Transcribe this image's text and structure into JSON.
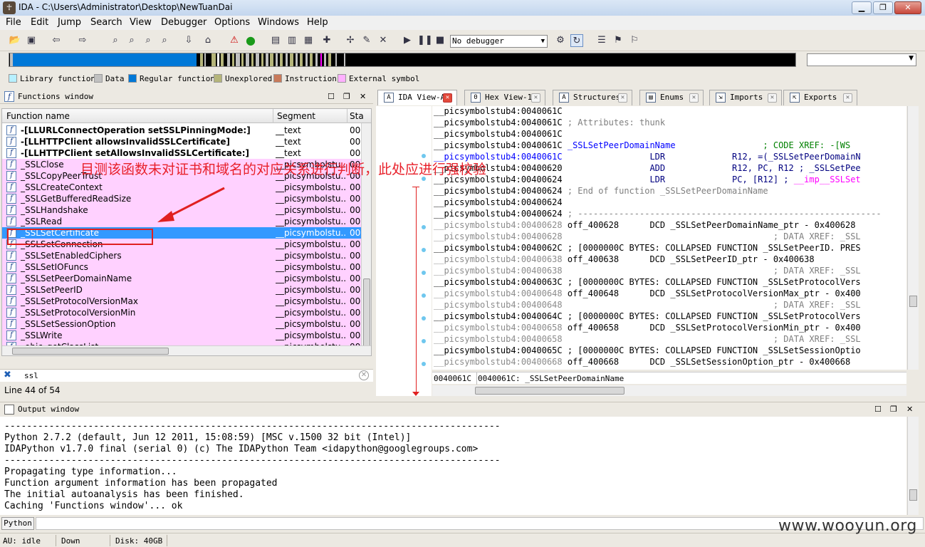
{
  "window": {
    "title": "IDA - C:\\Users\\Administrator\\Desktop\\NewTuanDai"
  },
  "menu": [
    "File",
    "Edit",
    "Jump",
    "Search",
    "View",
    "Debugger",
    "Options",
    "Windows",
    "Help"
  ],
  "toolbar": {
    "debugger_select": "No debugger"
  },
  "legend": [
    {
      "label": "Library function",
      "color": "#b7f0ff"
    },
    {
      "label": "Data",
      "color": "#c0c0c0"
    },
    {
      "label": "Regular function",
      "color": "#0078d7"
    },
    {
      "label": "Unexplored",
      "color": "#b5b57a"
    },
    {
      "label": "Instruction",
      "color": "#c87a5a"
    },
    {
      "label": "External symbol",
      "color": "#ffb0ff"
    }
  ],
  "functions_window": {
    "title": "Functions window",
    "columns": [
      "Function name",
      "Segment",
      "Sta"
    ],
    "rows": [
      {
        "name": "-[LLURLConnectOperation setSSLPinningMode:]",
        "segment": "__text",
        "start": "00",
        "bold": true
      },
      {
        "name": "-[LLHTTPClient allowsInvalidSSLCertificate]",
        "segment": "__text",
        "start": "00",
        "bold": true
      },
      {
        "name": "-[LLHTTPClient setAllowsInvalidSSLCertificate:]",
        "segment": "__text",
        "start": "00",
        "bold": true
      },
      {
        "name": "_SSLClose",
        "segment": "__picsymbolstu...",
        "start": "00"
      },
      {
        "name": "_SSLCopyPeerTrust",
        "segment": "__picsymbolstu...",
        "start": "00"
      },
      {
        "name": "_SSLCreateContext",
        "segment": "__picsymbolstu...",
        "start": "00"
      },
      {
        "name": "_SSLGetBufferedReadSize",
        "segment": "__picsymbolstu...",
        "start": "00"
      },
      {
        "name": "_SSLHandshake",
        "segment": "__picsymbolstu...",
        "start": "00"
      },
      {
        "name": "_SSLRead",
        "segment": "__picsymbolstu...",
        "start": "00"
      },
      {
        "name": "_SSLSetCertificate",
        "segment": "__picsymbolstu...",
        "start": "00",
        "selected": true
      },
      {
        "name": "_SSLSetConnection",
        "segment": "__picsymbolstu...",
        "start": "00"
      },
      {
        "name": "_SSLSetEnabledCiphers",
        "segment": "__picsymbolstu...",
        "start": "00"
      },
      {
        "name": "_SSLSetIOFuncs",
        "segment": "__picsymbolstu...",
        "start": "00"
      },
      {
        "name": "_SSLSetPeerDomainName",
        "segment": "__picsymbolstu...",
        "start": "00"
      },
      {
        "name": "_SSLSetPeerID",
        "segment": "__picsymbolstu...",
        "start": "00"
      },
      {
        "name": "_SSLSetProtocolVersionMax",
        "segment": "__picsymbolstu...",
        "start": "00"
      },
      {
        "name": "_SSLSetProtocolVersionMin",
        "segment": "__picsymbolstu...",
        "start": "00"
      },
      {
        "name": "_SSLSetSessionOption",
        "segment": "__picsymbolstu...",
        "start": "00"
      },
      {
        "name": "_SSLWrite",
        "segment": "__picsymbolstu...",
        "start": "00"
      },
      {
        "name": "_objc_getClassList",
        "segment": "__picsymbolstu...",
        "start": "00"
      }
    ],
    "filter": "ssl",
    "line_status": "Line 44 of 54"
  },
  "tabs": [
    {
      "label": "IDA View-A",
      "active": true
    },
    {
      "label": "Hex View-1"
    },
    {
      "label": "Structures"
    },
    {
      "label": "Enums"
    },
    {
      "label": "Imports"
    },
    {
      "label": "Exports"
    }
  ],
  "ida_view": {
    "lines": [
      {
        "addr": "__picsymbolstub4:0040061C",
        "dim": false,
        "segs": []
      },
      {
        "addr": "__picsymbolstub4:0040061C",
        "dim": false,
        "segs": [
          [
            "c-cmt",
            " ; Attributes: thunk"
          ]
        ]
      },
      {
        "addr": "__picsymbolstub4:0040061C",
        "dim": false,
        "segs": []
      },
      {
        "addr": "__picsymbolstub4:0040061C",
        "dim": false,
        "segs": [
          [
            "c-name",
            " _SSLSetPeerDomainName"
          ],
          [
            "c-xref",
            "                 ; CODE XREF: -[WS"
          ]
        ]
      },
      {
        "addr": "__picsymbolstub4:0040061C",
        "dim": false,
        "blue": true,
        "segs": [
          [
            "c-ins",
            "                 LDR             R12, =(_SSLSetPeerDomainN"
          ]
        ]
      },
      {
        "addr": "__picsymbolstub4:00400620",
        "dim": false,
        "segs": [
          [
            "c-ins",
            "                 ADD             R12, PC, R12 ; _SSLSetPee"
          ]
        ]
      },
      {
        "addr": "__picsymbolstub4:00400624",
        "dim": false,
        "segs": [
          [
            "c-ins",
            "                 LDR             PC, [R12] ; "
          ],
          [
            "c-imp",
            "__imp__SSLSet"
          ]
        ]
      },
      {
        "addr": "__picsymbolstub4:00400624",
        "dim": false,
        "segs": [
          [
            "c-cmt",
            " ; End of function _SSLSetPeerDomainName"
          ]
        ]
      },
      {
        "addr": "__picsymbolstub4:00400624",
        "dim": false,
        "segs": []
      },
      {
        "addr": "__picsymbolstub4:00400624",
        "dim": false,
        "segs": [
          [
            "c-cmt",
            " ; -----------------------------------------------------------"
          ]
        ]
      },
      {
        "addr": "__picsymbolstub4:00400628",
        "dim": true,
        "segs": [
          [
            "c-blk",
            " off_400628      DCD _SSLSetPeerDomainName_ptr - 0x400628"
          ]
        ]
      },
      {
        "addr": "__picsymbolstub4:00400628",
        "dim": true,
        "segs": [
          [
            "c-cmt",
            "                                         ; DATA XREF: _SSL"
          ]
        ]
      },
      {
        "addr": "__picsymbolstub4:0040062C",
        "dim": false,
        "segs": [
          [
            "c-blk",
            " ; [0000000C BYTES: COLLAPSED FUNCTION _SSLSetPeerID. PRES"
          ]
        ]
      },
      {
        "addr": "__picsymbolstub4:00400638",
        "dim": true,
        "segs": [
          [
            "c-blk",
            " off_400638      DCD _SSLSetPeerID_ptr - 0x400638"
          ]
        ]
      },
      {
        "addr": "__picsymbolstub4:00400638",
        "dim": true,
        "segs": [
          [
            "c-cmt",
            "                                         ; DATA XREF: _SSL"
          ]
        ]
      },
      {
        "addr": "__picsymbolstub4:0040063C",
        "dim": false,
        "segs": [
          [
            "c-blk",
            " ; [0000000C BYTES: COLLAPSED FUNCTION _SSLSetProtocolVers"
          ]
        ]
      },
      {
        "addr": "__picsymbolstub4:00400648",
        "dim": true,
        "segs": [
          [
            "c-blk",
            " off_400648      DCD _SSLSetProtocolVersionMax_ptr - 0x400"
          ]
        ]
      },
      {
        "addr": "__picsymbolstub4:00400648",
        "dim": true,
        "segs": [
          [
            "c-cmt",
            "                                         ; DATA XREF: _SSL"
          ]
        ]
      },
      {
        "addr": "__picsymbolstub4:0040064C",
        "dim": false,
        "segs": [
          [
            "c-blk",
            " ; [0000000C BYTES: COLLAPSED FUNCTION _SSLSetProtocolVers"
          ]
        ]
      },
      {
        "addr": "__picsymbolstub4:00400658",
        "dim": true,
        "segs": [
          [
            "c-blk",
            " off_400658      DCD _SSLSetProtocolVersionMin_ptr - 0x400"
          ]
        ]
      },
      {
        "addr": "__picsymbolstub4:00400658",
        "dim": true,
        "segs": [
          [
            "c-cmt",
            "                                         ; DATA XREF: _SSL"
          ]
        ]
      },
      {
        "addr": "__picsymbolstub4:0040065C",
        "dim": false,
        "segs": [
          [
            "c-blk",
            " ; [0000000C BYTES: COLLAPSED FUNCTION _SSLSetSessionOptio"
          ]
        ]
      },
      {
        "addr": "__picsymbolstub4:00400668",
        "dim": true,
        "segs": [
          [
            "c-blk",
            " off_400668      DCD _SSLSetSessionOption_ptr - 0x400668"
          ]
        ]
      }
    ],
    "status_offset": "0040061C",
    "status_text": "0040061C: _SSLSetPeerDomainName"
  },
  "output_window": {
    "title": "Output window",
    "lines": [
      "-----------------------------------------------------------------------------------------",
      "Python 2.7.2 (default, Jun 12 2011, 15:08:59) [MSC v.1500 32 bit (Intel)]",
      "IDAPython v1.7.0 final (serial 0) (c) The IDAPython Team <idapython@googlegroups.com>",
      "-----------------------------------------------------------------------------------------",
      "Propagating type information...",
      "Function argument information has been propagated",
      "The initial autoanalysis has been finished.",
      "Caching 'Functions window'... ok"
    ],
    "python_button": "Python"
  },
  "statusbar": {
    "state": "AU:  idle",
    "direction": "Down",
    "disk": "Disk: 40GB"
  },
  "annotation": "目测该函数未对证书和域名的对应关系进行判断，此处应进行强校验",
  "watermark": "www.wooyun.org"
}
